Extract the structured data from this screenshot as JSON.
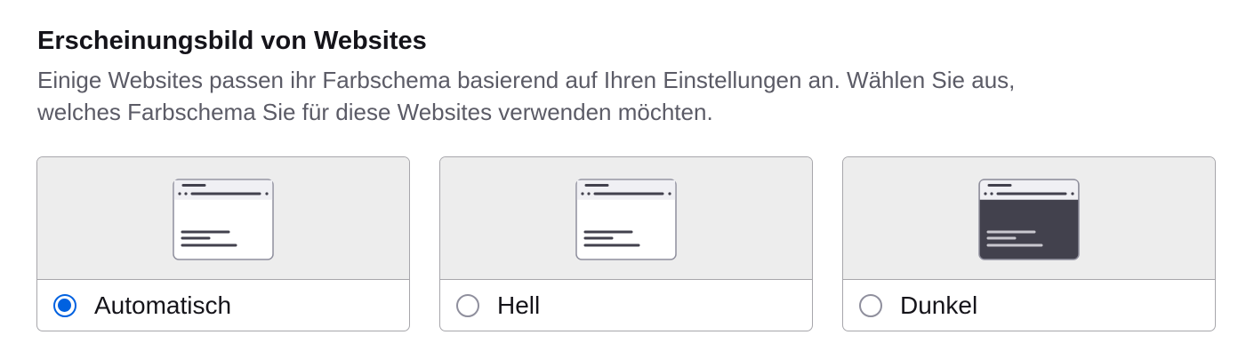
{
  "section": {
    "title": "Erscheinungsbild von Websites",
    "description_line1": "Einige Websites passen ihr Farbschema basierend auf Ihren Einstellungen an. Wählen Sie aus,",
    "description_line2": "welches Farbschema Sie für diese Websites verwenden möchten."
  },
  "options": [
    {
      "label": "Automatisch",
      "selected": true,
      "preview_icon": "browser-window-light-icon"
    },
    {
      "label": "Hell",
      "selected": false,
      "preview_icon": "browser-window-light-icon"
    },
    {
      "label": "Dunkel",
      "selected": false,
      "preview_icon": "browser-window-dark-icon"
    }
  ],
  "colors": {
    "accent": "#0061e0",
    "text": "#15141a",
    "secondary_text": "#5b5b66",
    "card_border": "#a7a6ab",
    "preview_bg": "#ededed",
    "dark_window": "#42414d"
  }
}
